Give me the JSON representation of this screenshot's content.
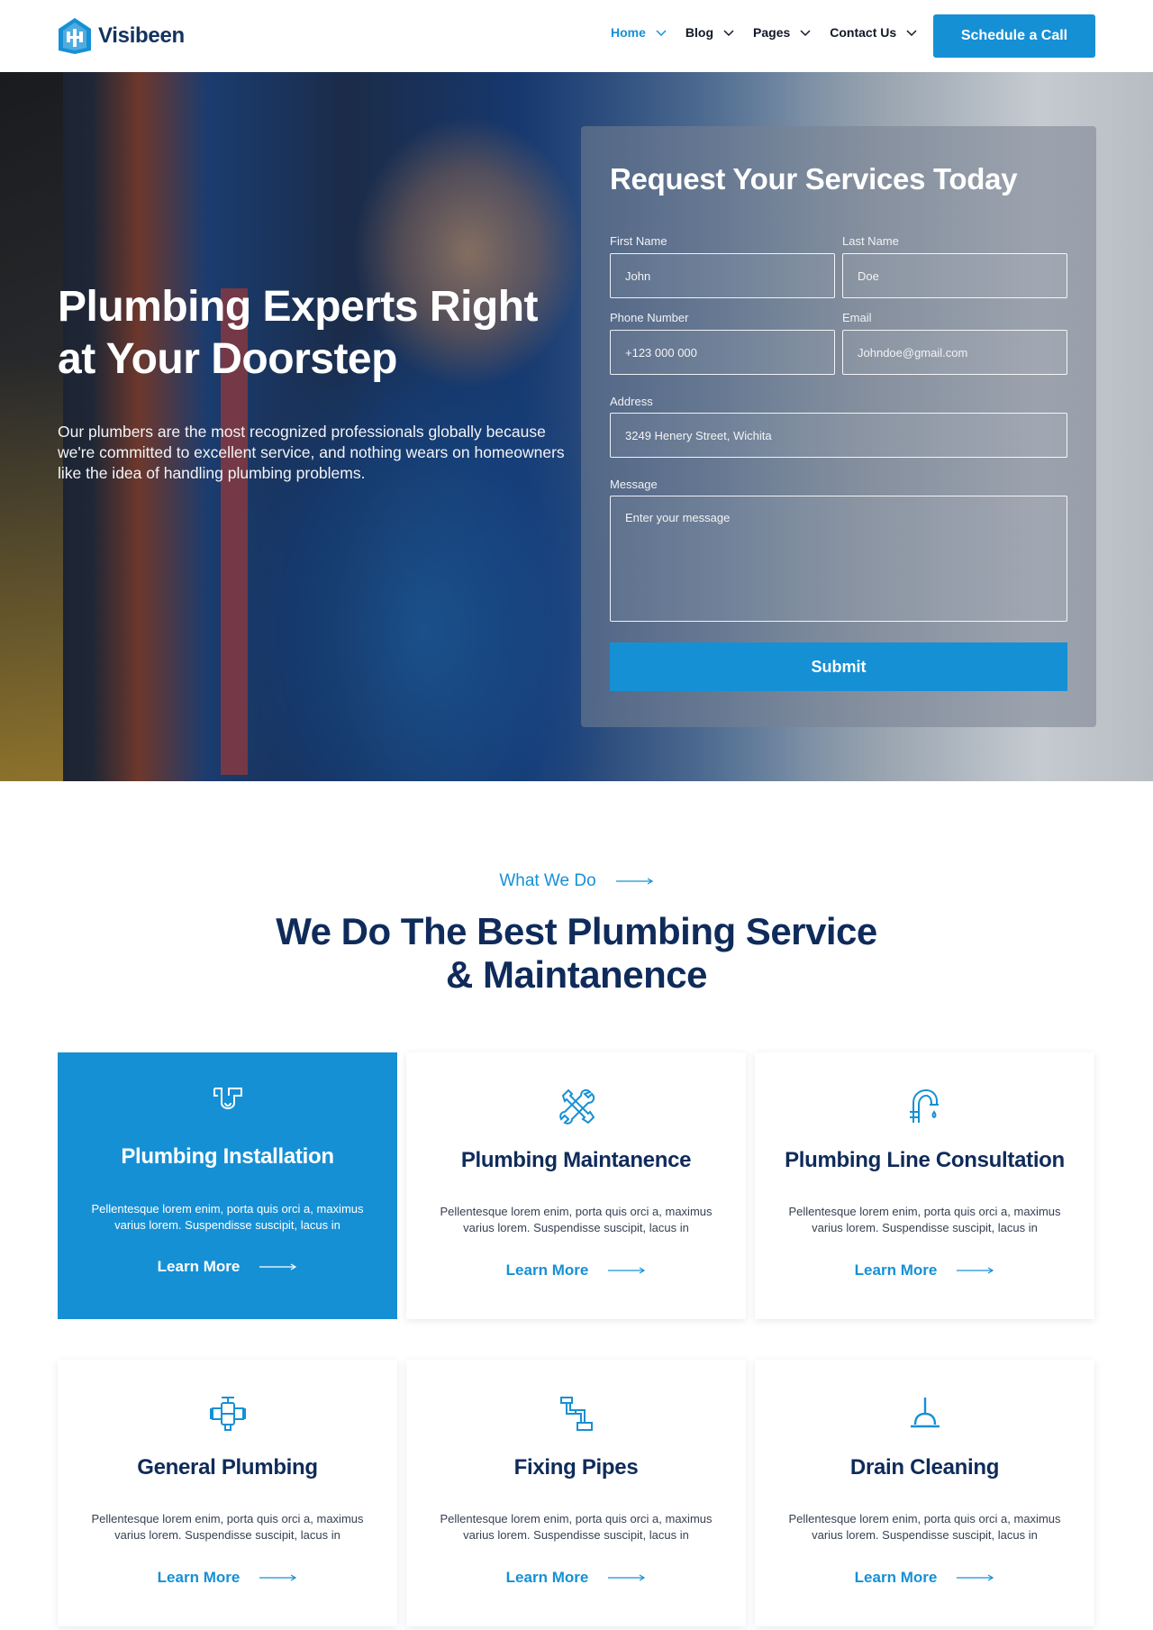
{
  "brand": {
    "name": "Visibeen",
    "accent": "#1690d5",
    "navy": "#0f2b5b"
  },
  "nav": {
    "items": [
      {
        "label": "Home",
        "icon": "chevron-down-icon"
      },
      {
        "label": "Blog",
        "icon": "chevron-down-icon"
      },
      {
        "label": "Pages",
        "icon": "chevron-down-icon"
      },
      {
        "label": "Contact Us",
        "icon": "chevron-down-icon"
      }
    ],
    "cta": "Schedule a Call"
  },
  "hero": {
    "title": "Plumbing Experts Right at Your Doorstep",
    "description": "Our plumbers are the most recognized professionals globally because we're committed to excellent service, and nothing wears on homeowners like the idea of handling plumbing problems."
  },
  "form": {
    "title": "Request Your Services Today",
    "first_name": {
      "label": "First Name",
      "placeholder": "John"
    },
    "last_name": {
      "label": "Last Name",
      "placeholder": "Doe"
    },
    "phone": {
      "label": "Phone Number",
      "placeholder": "+123 000 000"
    },
    "email": {
      "label": "Email",
      "placeholder": "Johndoe@gmail.com"
    },
    "address": {
      "label": "Address",
      "placeholder": "3249 Henery Street, Wichita"
    },
    "message": {
      "label": "Message",
      "placeholder": "Enter your message"
    },
    "submit": "Submit"
  },
  "services": {
    "eyebrow": "What We Do",
    "title_line1": "We Do The Best Plumbing Service",
    "title_line2": "& Maintanence",
    "cards": [
      {
        "title": "Plumbing Installation",
        "text": "Pellentesque lorem enim, porta quis orci a, maximus varius lorem. Suspendisse suscipit, lacus in",
        "link": "Learn More",
        "icon": "pipe-trap-icon"
      },
      {
        "title": "Plumbing Maintanence",
        "text": "Pellentesque lorem enim, porta quis orci a, maximus varius lorem. Suspendisse suscipit, lacus in",
        "link": "Learn More",
        "icon": "wrench-screwdriver-icon"
      },
      {
        "title": "Plumbing Line Consultation",
        "text": "Pellentesque lorem enim, porta quis orci a, maximus varius lorem. Suspendisse suscipit, lacus in",
        "link": "Learn More",
        "icon": "faucet-icon"
      },
      {
        "title": "General Plumbing",
        "text": "Pellentesque lorem enim, porta quis orci a, maximus varius lorem. Suspendisse suscipit, lacus in",
        "link": "Learn More",
        "icon": "valve-icon"
      },
      {
        "title": "Fixing Pipes",
        "text": "Pellentesque lorem enim, porta quis orci a, maximus varius lorem. Suspendisse suscipit, lacus in",
        "link": "Learn More",
        "icon": "pipe-icon"
      },
      {
        "title": "Drain Cleaning",
        "text": "Pellentesque lorem enim, porta quis orci a, maximus varius lorem. Suspendisse suscipit, lacus in",
        "link": "Learn More",
        "icon": "plunger-icon"
      }
    ]
  }
}
